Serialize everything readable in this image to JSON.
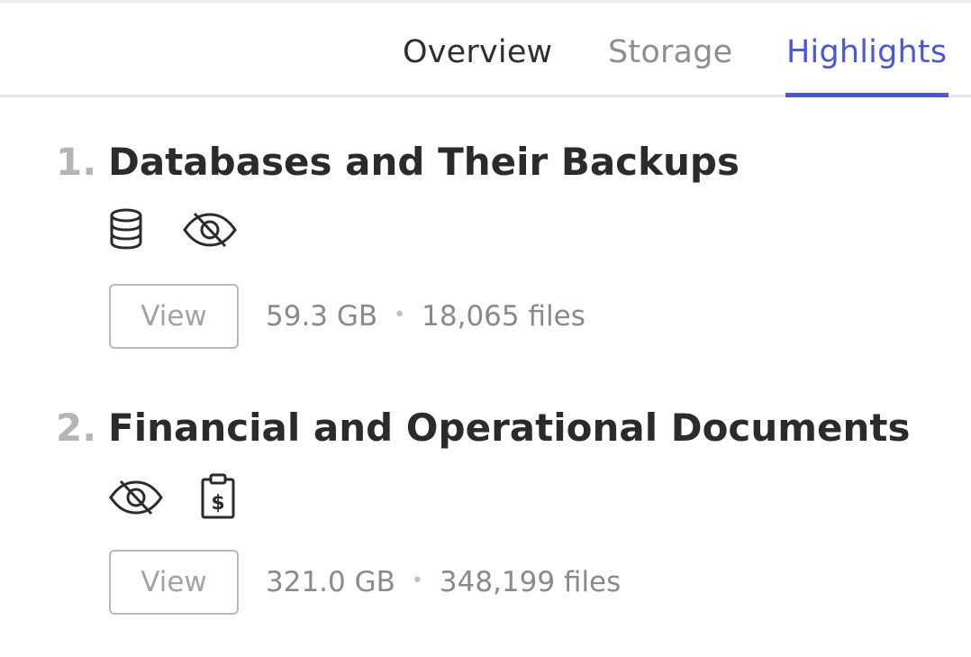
{
  "tabs": {
    "overview": "Overview",
    "storage": "Storage",
    "highlights": "Highlights",
    "active": "Highlights",
    "active_color": "#4b56d8"
  },
  "items": [
    {
      "number": "1.",
      "title": "Databases and Their Backups",
      "icons": [
        "database-icon",
        "eye-slash-icon"
      ],
      "view_label": "View",
      "size": "59.3 GB",
      "separator": "•",
      "files": "18,065 files"
    },
    {
      "number": "2.",
      "title": "Financial and Operational Documents",
      "icons": [
        "eye-slash-icon",
        "clipboard-dollar-icon"
      ],
      "view_label": "View",
      "size": "321.0 GB",
      "separator": "•",
      "files": "348,199 files"
    }
  ]
}
